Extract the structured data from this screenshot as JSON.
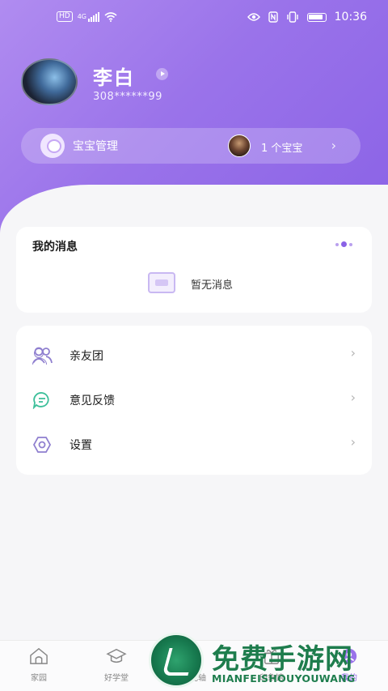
{
  "status_bar": {
    "left_badge": "HD",
    "network": "4G",
    "time": "10:36",
    "icons": [
      "hd-icon",
      "signal-icon",
      "wifi-icon",
      "eye-icon",
      "nfc-icon",
      "vibrate-icon",
      "battery-icon"
    ]
  },
  "profile": {
    "name": "李白",
    "phone": "308******99"
  },
  "baby": {
    "label": "宝宝管理",
    "count": "1 个宝宝"
  },
  "messages": {
    "title": "我的消息",
    "empty_text": "暂无消息"
  },
  "menu": {
    "items": [
      {
        "label": "亲友团",
        "icon": "friends-icon"
      },
      {
        "label": "意见反馈",
        "icon": "feedback-icon"
      },
      {
        "label": "设置",
        "icon": "settings-icon"
      }
    ]
  },
  "bottom_nav": {
    "items": [
      {
        "label": "家园"
      },
      {
        "label": "好学堂"
      },
      {
        "label": "时光轴"
      },
      {
        "label": "印象馆"
      },
      {
        "label": "我的"
      }
    ],
    "active": "我的"
  },
  "watermark": {
    "title": "免费手游网",
    "subtitle": "MIANFEISHOUYOUWANG"
  },
  "colors": {
    "accent": "#8a62e6",
    "header_gradient_start": "#b08cf0",
    "feedback_icon": "#3cbf9a",
    "watermark_green": "#1e7d4d"
  }
}
